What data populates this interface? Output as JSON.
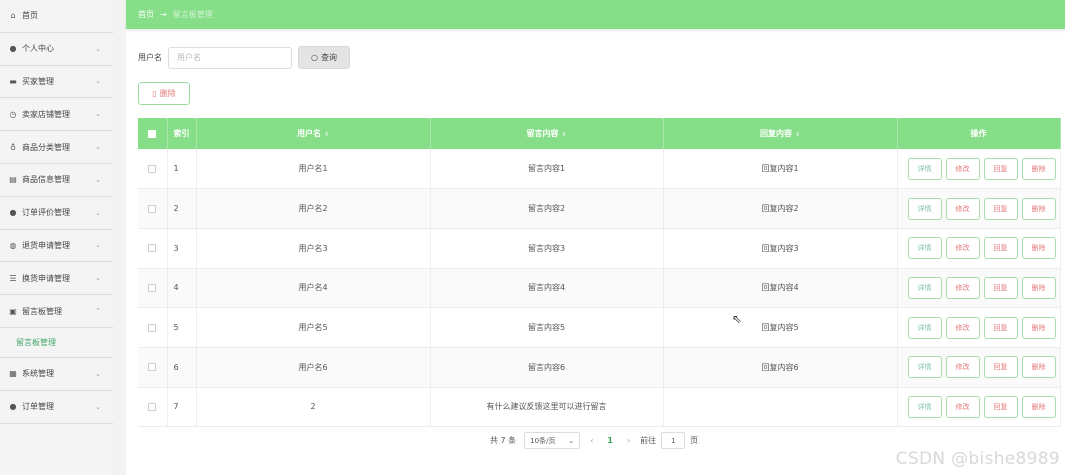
{
  "sidebar": {
    "items": [
      {
        "label": "首页",
        "icon": "home-icon",
        "glyph": "⌂",
        "chevron": ""
      },
      {
        "label": "个人中心",
        "icon": "user-icon",
        "glyph": "●",
        "chevron": "⌄"
      },
      {
        "label": "买家管理",
        "icon": "card-icon",
        "glyph": "▬",
        "chevron": "⌄"
      },
      {
        "label": "卖家店铺管理",
        "icon": "clock-icon",
        "glyph": "◷",
        "chevron": "⌄"
      },
      {
        "label": "商品分类管理",
        "icon": "bulb-icon",
        "glyph": "♁",
        "chevron": "⌄"
      },
      {
        "label": "商品信息管理",
        "icon": "ticket-icon",
        "glyph": "▤",
        "chevron": "⌄"
      },
      {
        "label": "订单评价管理",
        "icon": "user-icon",
        "glyph": "●",
        "chevron": "⌄"
      },
      {
        "label": "退货申请管理",
        "icon": "globe-icon",
        "glyph": "◍",
        "chevron": "⌄"
      },
      {
        "label": "换货申请管理",
        "icon": "list-icon",
        "glyph": "☰",
        "chevron": "⌄"
      },
      {
        "label": "留言板管理",
        "icon": "briefcase-icon",
        "glyph": "▣",
        "chevron": "⌃"
      }
    ],
    "sub_item": "留言板管理",
    "items_after": [
      {
        "label": "系统管理",
        "icon": "grid-icon",
        "glyph": "▦",
        "chevron": "⌄"
      },
      {
        "label": "订单管理",
        "icon": "user-icon",
        "glyph": "●",
        "chevron": "⌄"
      }
    ]
  },
  "breadcrumb": {
    "home": "首页",
    "arrow": "→",
    "current": "留言板管理"
  },
  "search": {
    "label": "用户名",
    "placeholder": "用户名",
    "button": "查询"
  },
  "toolbar": {
    "delete": "删除"
  },
  "table": {
    "headers": [
      "",
      "索引",
      "用户名",
      "留言内容",
      "回复内容",
      "操作"
    ],
    "rows": [
      {
        "idx": "1",
        "user": "用户名1",
        "msg": "留言内容1",
        "reply": "回复内容1"
      },
      {
        "idx": "2",
        "user": "用户名2",
        "msg": "留言内容2",
        "reply": "回复内容2"
      },
      {
        "idx": "3",
        "user": "用户名3",
        "msg": "留言内容3",
        "reply": "回复内容3"
      },
      {
        "idx": "4",
        "user": "用户名4",
        "msg": "留言内容4",
        "reply": "回复内容4"
      },
      {
        "idx": "5",
        "user": "用户名5",
        "msg": "留言内容5",
        "reply": "回复内容5"
      },
      {
        "idx": "6",
        "user": "用户名6",
        "msg": "留言内容6",
        "reply": "回复内容6"
      },
      {
        "idx": "7",
        "user": "2",
        "msg": "有什么建议反馈这里可以进行留言",
        "reply": ""
      }
    ],
    "actions": {
      "detail": "详情",
      "edit": "修改",
      "reply": "回复",
      "remove": "删除"
    }
  },
  "pagination": {
    "total": "共 7 条",
    "page_size": "10条/页",
    "current_page": "1",
    "goto_label": "前往",
    "goto_value": "1",
    "page_suffix": "页"
  },
  "watermark": "CSDN @bishe8989",
  "colors": {
    "accent": "#86de89",
    "danger": "#e57a7a"
  }
}
